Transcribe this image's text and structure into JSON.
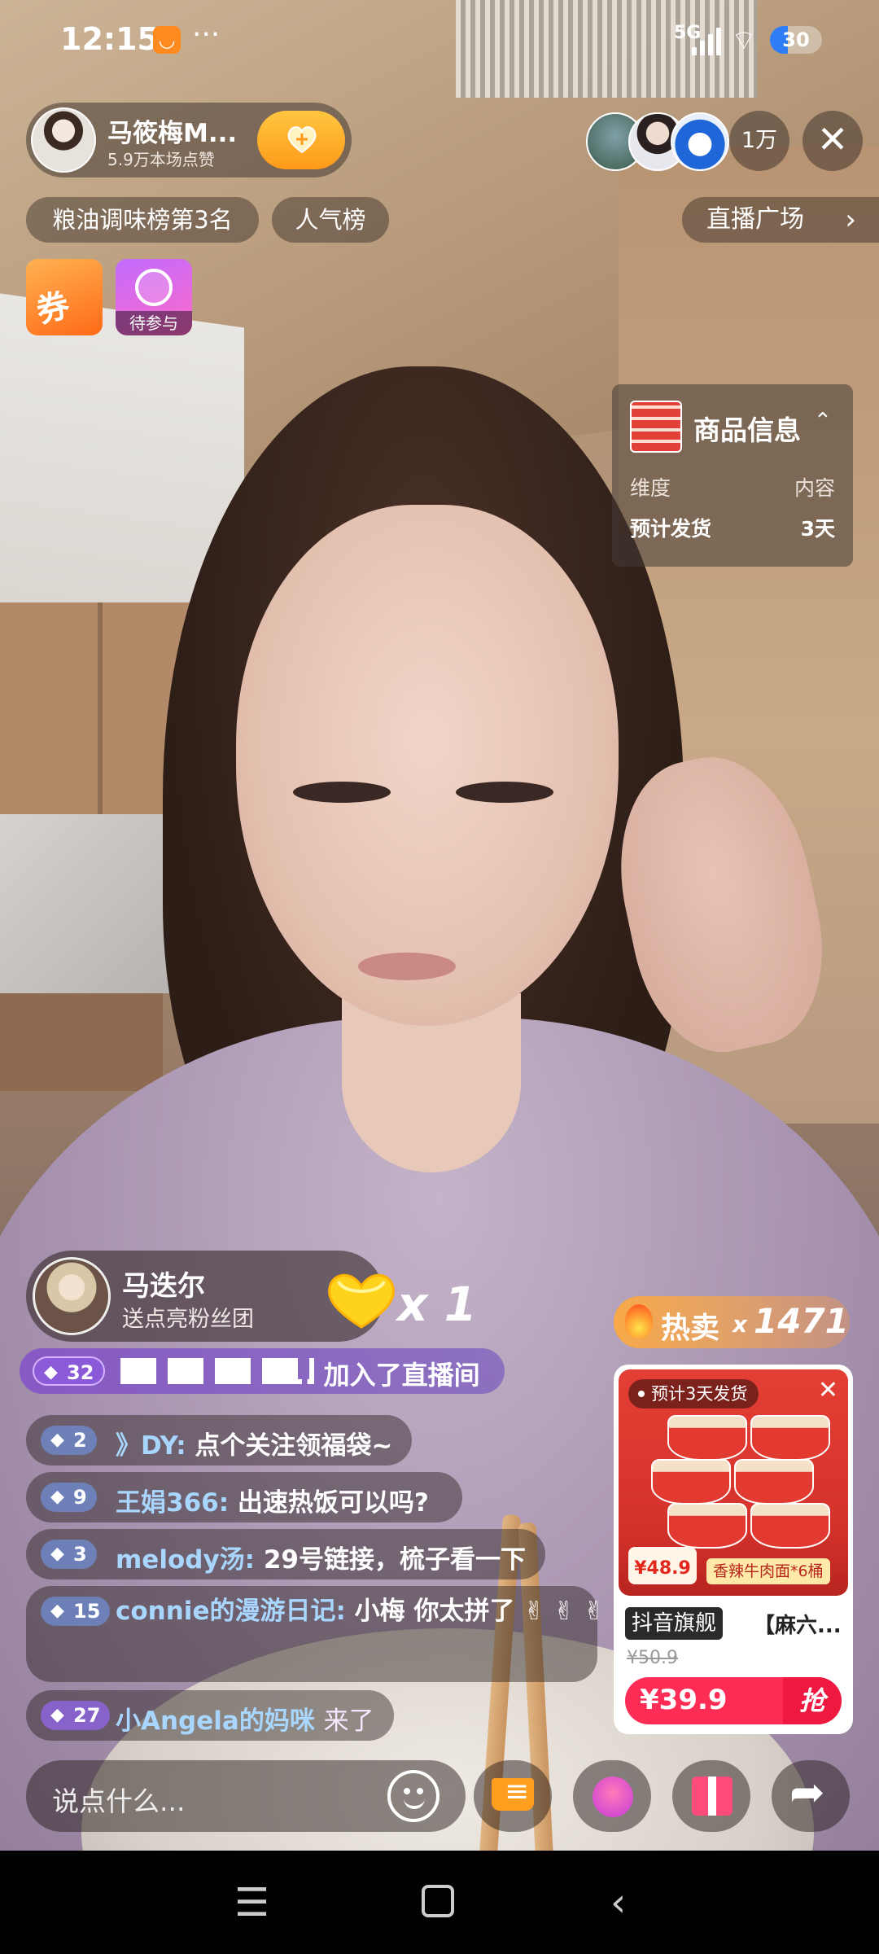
{
  "status_bar": {
    "time": "12:15",
    "dots": "···",
    "network": "5G",
    "battery": "30"
  },
  "host": {
    "name": "马筱梅M...",
    "likes": "5.9万本场点赞",
    "follow_icon": "heart-plus-icon"
  },
  "viewers": {
    "count": "1万"
  },
  "tags": {
    "rank": "粮油调味榜第3名",
    "popularity": "人气榜",
    "plaza": "直播广场"
  },
  "activities": {
    "coupon": "券",
    "gift_label": "待参与"
  },
  "product_info": {
    "title": "商品信息",
    "header_key": "维度",
    "header_value": "内容",
    "rows": [
      {
        "key": "预计发货",
        "value": "3天"
      }
    ]
  },
  "gift_notice": {
    "user": "马迭尔",
    "text": "送点亮粉丝团",
    "count": "x 1"
  },
  "join_banner": {
    "level": "32",
    "text": "... 加入了直播间"
  },
  "chat": [
    {
      "level": "2",
      "user": "》DY",
      "message": "点个关注领福袋~"
    },
    {
      "level": "9",
      "user": "王娟366",
      "message": "出速热饭可以吗?"
    },
    {
      "level": "3",
      "user": "melody汤",
      "message": "29号链接，梳子看一下"
    },
    {
      "level": "15",
      "user": "connie的漫游日记",
      "message": "小梅 你太拼了 ✌ ✌ ✌"
    },
    {
      "level": "27",
      "user": "小Angela的妈咪",
      "message": "来了"
    }
  ],
  "hot_sale": {
    "label": "热卖",
    "x": "x",
    "count": "1471"
  },
  "product_card": {
    "ship_badge": "预计3天发货",
    "promo_price": "¥48.9",
    "flavor": "香辣牛肉面*6桶",
    "brand_tag": "抖音旗舰",
    "title": "【麻六...",
    "old_price": "¥50.9",
    "price": "¥39.9",
    "grab": "抢"
  },
  "input": {
    "placeholder": "说点什么..."
  },
  "colors": {
    "accent": "#fe2c55",
    "follow_gold": "#ffb02e",
    "chat_user": "#a8d6ff"
  }
}
